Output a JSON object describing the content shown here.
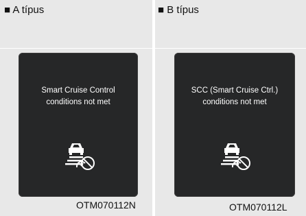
{
  "panels": [
    {
      "title": "■ A típus",
      "message_line1": "Smart Cruise Control",
      "message_line2": "conditions not met",
      "icon": "car-distance-prohibited-icon",
      "code": "OTM070112N"
    },
    {
      "title": "■ B típus",
      "message_line1": "SCC (Smart Cruise Ctrl.)",
      "message_line2": "conditions not met",
      "icon": "car-distance-prohibited-icon",
      "code": "OTM070112L"
    }
  ],
  "colors": {
    "panel_bg": "#e8e8e8",
    "screen_bg": "#262728",
    "screen_text": "#ffffff"
  }
}
